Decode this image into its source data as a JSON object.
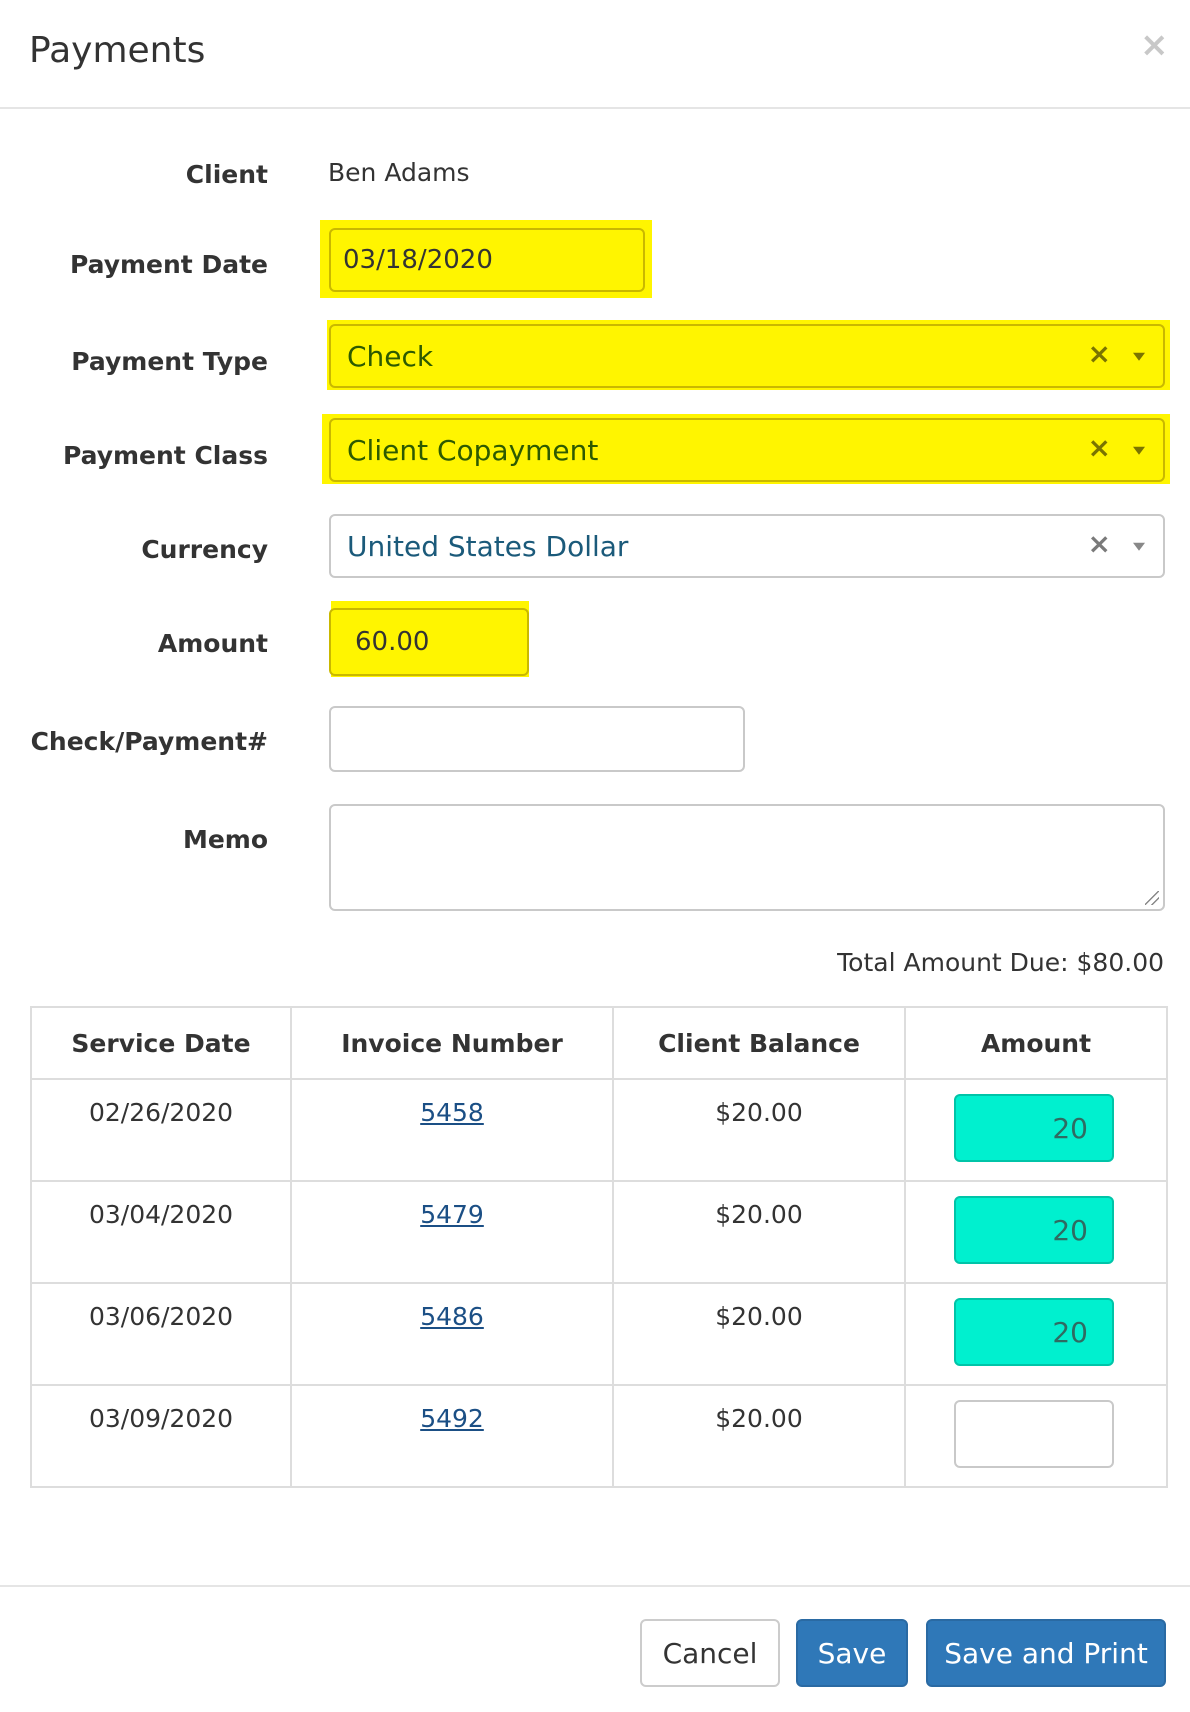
{
  "dialog": {
    "title": "Payments",
    "close_symbol": "×"
  },
  "form": {
    "client_label": "Client",
    "client_value": "Ben Adams",
    "payment_date_label": "Payment Date",
    "payment_date_value": "03/18/2020",
    "payment_type_label": "Payment Type",
    "payment_type_value": "Check",
    "payment_class_label": "Payment Class",
    "payment_class_value": "Client Copayment",
    "currency_label": "Currency",
    "currency_value": "United States Dollar",
    "amount_label": "Amount",
    "amount_value": "60.00",
    "check_label": "Check/Payment#",
    "check_value": "",
    "memo_label": "Memo",
    "memo_value": "",
    "clear_symbol": "×"
  },
  "total_due": "Total Amount Due: $80.00",
  "table": {
    "headers": [
      "Service Date",
      "Invoice Number",
      "Client Balance",
      "Amount"
    ],
    "rows": [
      {
        "service_date": "02/26/2020",
        "invoice": "5458",
        "balance": "$20.00",
        "amount": "20"
      },
      {
        "service_date": "03/04/2020",
        "invoice": "5479",
        "balance": "$20.00",
        "amount": "20"
      },
      {
        "service_date": "03/06/2020",
        "invoice": "5486",
        "balance": "$20.00",
        "amount": "20"
      },
      {
        "service_date": "03/09/2020",
        "invoice": "5492",
        "balance": "$20.00",
        "amount": ""
      }
    ]
  },
  "footer": {
    "cancel_label": "Cancel",
    "save_label": "Save",
    "save_print_label": "Save and Print"
  },
  "colors": {
    "highlight_yellow": "#fff500",
    "highlight_teal": "#00f0cf",
    "primary_button": "#2f78b8",
    "link": "#1b4f85"
  }
}
